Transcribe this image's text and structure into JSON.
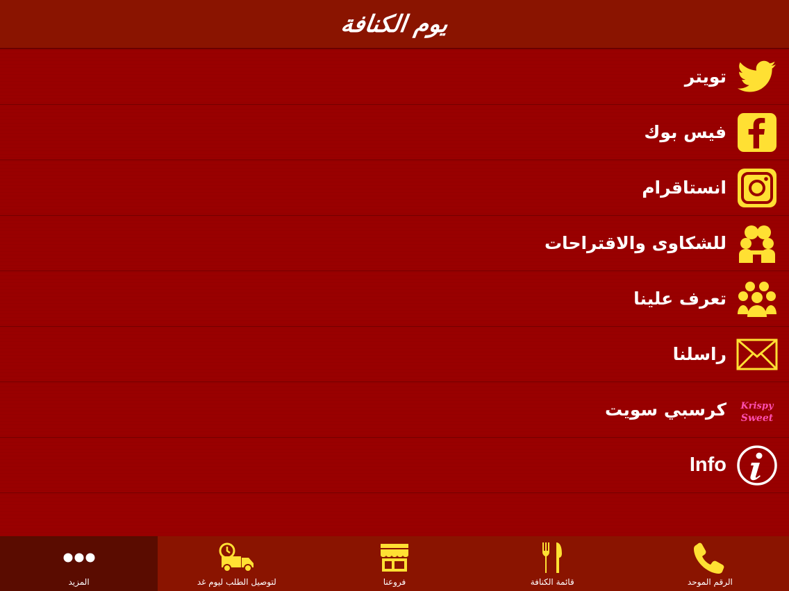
{
  "header": {
    "logo_text": "يوم الكنافة"
  },
  "menu": {
    "items": [
      {
        "label": "تويتر",
        "icon": "twitter-icon"
      },
      {
        "label": "فيس بوك",
        "icon": "facebook-icon"
      },
      {
        "label": "انستاقرام",
        "icon": "instagram-icon"
      },
      {
        "label": "للشكاوى والاقتراحات",
        "icon": "feedback-people-icon"
      },
      {
        "label": "تعرف علينا",
        "icon": "group-people-icon"
      },
      {
        "label": "راسلنا",
        "icon": "mail-icon"
      },
      {
        "label": "كرسبي سويت",
        "icon": "krispy-sweet-logo-icon",
        "logo_text": "Krispy Sweet"
      },
      {
        "label": "Info",
        "icon": "info-icon"
      }
    ]
  },
  "tabbar": {
    "tabs": [
      {
        "label": "الرقم الموحد",
        "icon": "phone-icon"
      },
      {
        "label": "قائمة الكنافة",
        "icon": "fork-knife-icon"
      },
      {
        "label": "فروعنا",
        "icon": "store-icon"
      },
      {
        "label": "لتوصيل الطلب ليوم غد",
        "icon": "delivery-truck-icon"
      },
      {
        "label": "المزيد",
        "icon": "more-dots-icon",
        "active": true
      }
    ]
  },
  "colors": {
    "header_bg": "#8a1400",
    "menu_bg": "#990000",
    "icon_yellow": "#ffe033",
    "text": "#ffffff",
    "active_tab_bg": "#5a0c00"
  }
}
